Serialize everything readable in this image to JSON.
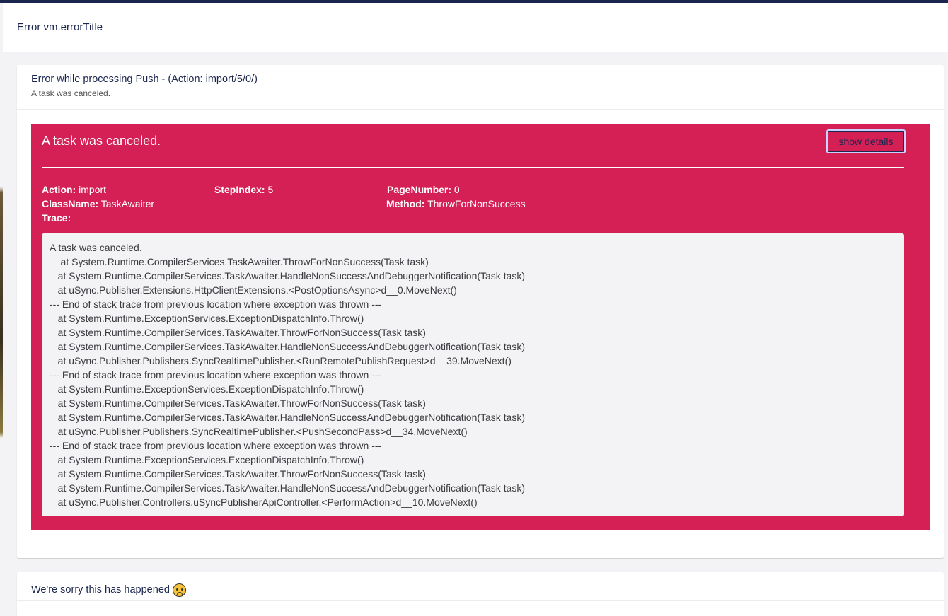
{
  "dialog": {
    "title": "Error vm.errorTitle"
  },
  "error_panel": {
    "title": "Error while processing Push - (Action: import/5/0/)",
    "subtitle": "A task was canceled.",
    "heading": "A task was canceled.",
    "details_button": "show details",
    "meta": {
      "action_key": "Action:",
      "action_value": "import",
      "stepindex_key": "StepIndex:",
      "stepindex_value": "5",
      "pagenumber_key": "PageNumber:",
      "pagenumber_value": "0",
      "classname_key": "ClassName:",
      "classname_value": "TaskAwaiter",
      "method_key": "Method:",
      "method_value": "ThrowForNonSuccess",
      "trace_key": "Trace:"
    },
    "trace_lines": [
      "A task was canceled.",
      "    at System.Runtime.CompilerServices.TaskAwaiter.ThrowForNonSuccess(Task task)",
      "   at System.Runtime.CompilerServices.TaskAwaiter.HandleNonSuccessAndDebuggerNotification(Task task)",
      "   at uSync.Publisher.Extensions.HttpClientExtensions.<PostOptionsAsync>d__0.MoveNext()",
      "--- End of stack trace from previous location where exception was thrown ---",
      "   at System.Runtime.ExceptionServices.ExceptionDispatchInfo.Throw()",
      "   at System.Runtime.CompilerServices.TaskAwaiter.ThrowForNonSuccess(Task task)",
      "   at System.Runtime.CompilerServices.TaskAwaiter.HandleNonSuccessAndDebuggerNotification(Task task)",
      "   at uSync.Publisher.Publishers.SyncRealtimePublisher.<RunRemotePublishRequest>d__39.MoveNext()",
      "--- End of stack trace from previous location where exception was thrown ---",
      "   at System.Runtime.ExceptionServices.ExceptionDispatchInfo.Throw()",
      "   at System.Runtime.CompilerServices.TaskAwaiter.ThrowForNonSuccess(Task task)",
      "   at System.Runtime.CompilerServices.TaskAwaiter.HandleNonSuccessAndDebuggerNotification(Task task)",
      "   at uSync.Publisher.Publishers.SyncRealtimePublisher.<PushSecondPass>d__34.MoveNext()",
      "--- End of stack trace from previous location where exception was thrown ---",
      "   at System.Runtime.ExceptionServices.ExceptionDispatchInfo.Throw()",
      "   at System.Runtime.CompilerServices.TaskAwaiter.ThrowForNonSuccess(Task task)",
      "   at System.Runtime.CompilerServices.TaskAwaiter.HandleNonSuccessAndDebuggerNotification(Task task)",
      "   at uSync.Publisher.Controllers.uSyncPublisherApiController.<PerformAction>d__10.MoveNext()"
    ]
  },
  "sorry_panel": {
    "title": "We're sorry this has happened",
    "icon": "sad-face-emoji"
  },
  "colors": {
    "error_background": "#d42054",
    "header_background": "#1b264f",
    "trace_background": "#f3f3f5"
  }
}
